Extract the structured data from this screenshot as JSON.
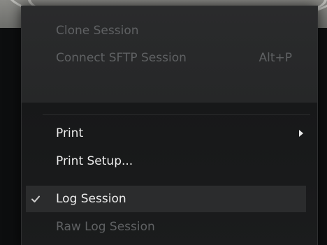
{
  "menu": {
    "items": [
      {
        "label": "Clone Session",
        "shortcut": "",
        "enabled": false
      },
      {
        "label": "Connect SFTP Session",
        "shortcut": "Alt+P",
        "enabled": false
      },
      {
        "label": "Print",
        "has_submenu": true,
        "enabled": true
      },
      {
        "label": "Print Setup...",
        "enabled": true
      },
      {
        "label": "Log Session",
        "checked": true,
        "enabled": true
      },
      {
        "label": "Raw Log Session",
        "enabled": false
      }
    ]
  },
  "colors": {
    "menu_background": "#242526",
    "menu_lower_background": "#171819",
    "text_enabled": "#ececec",
    "text_disabled": "#5f6163",
    "highlight": "#2b2c2d"
  },
  "icons": {
    "checkmark": "checkmark-icon",
    "submenu_arrow": "chevron-right-icon"
  }
}
